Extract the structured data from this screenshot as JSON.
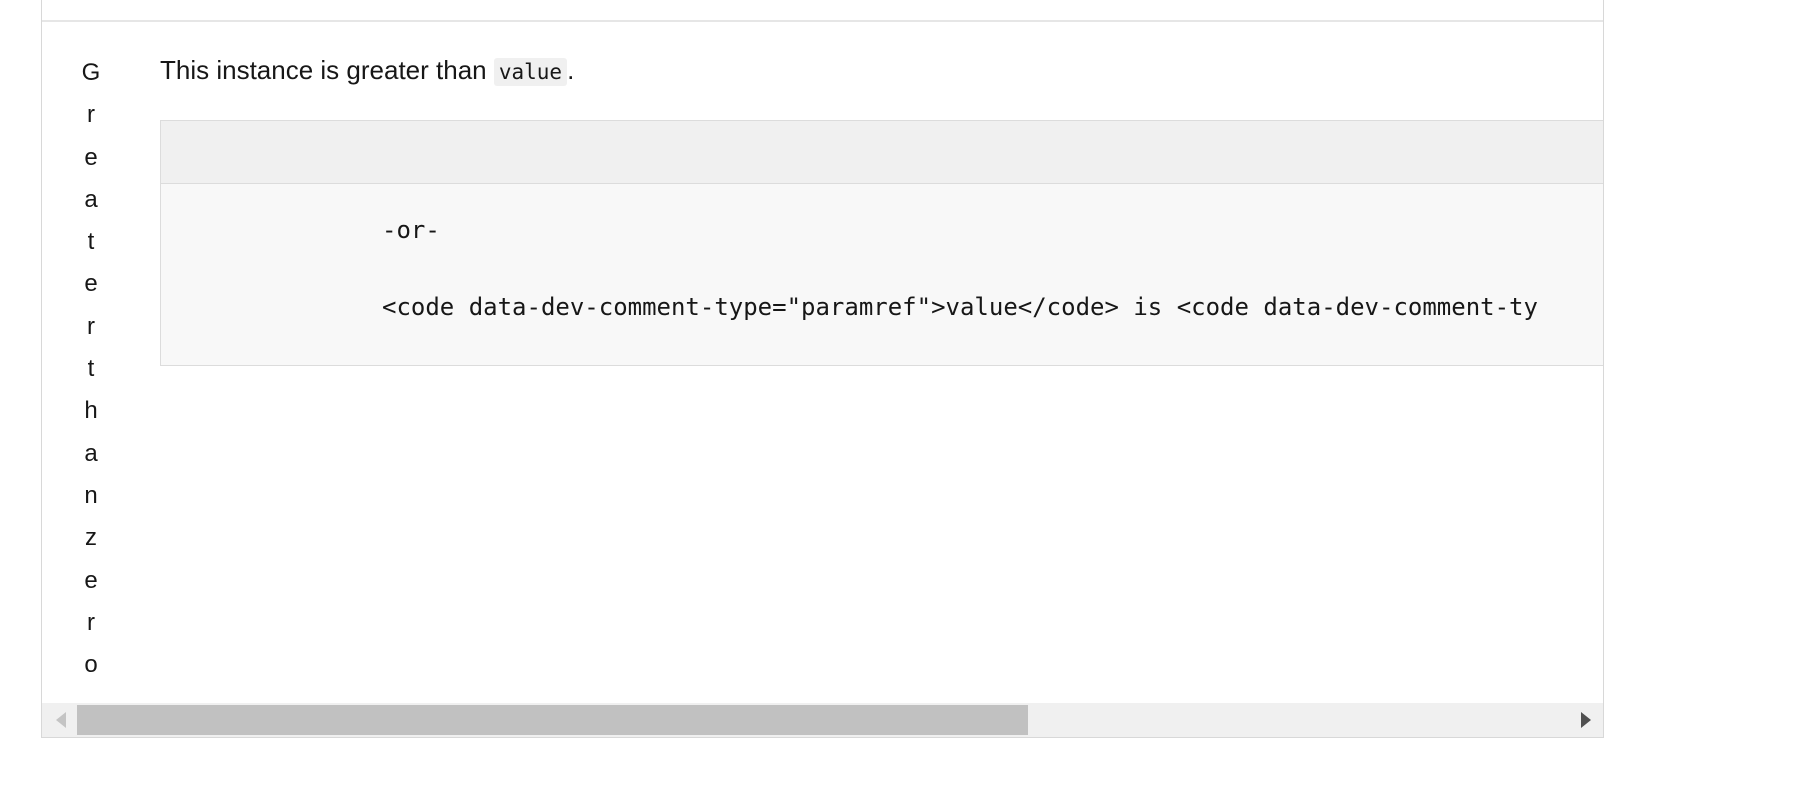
{
  "row": {
    "name_letters": [
      "G",
      "r",
      "e",
      "a",
      "t",
      "e",
      "r",
      "t",
      "h",
      "a",
      "n",
      "z",
      "e",
      "r",
      "o"
    ],
    "description_text": "This instance is greater than ",
    "description_code": "value",
    "description_end": "."
  },
  "code_block": {
    "lines": [
      "-or-",
      "<code data-dev-comment-type=\"paramref\">value</code> is <code data-dev-comment-ty"
    ]
  }
}
